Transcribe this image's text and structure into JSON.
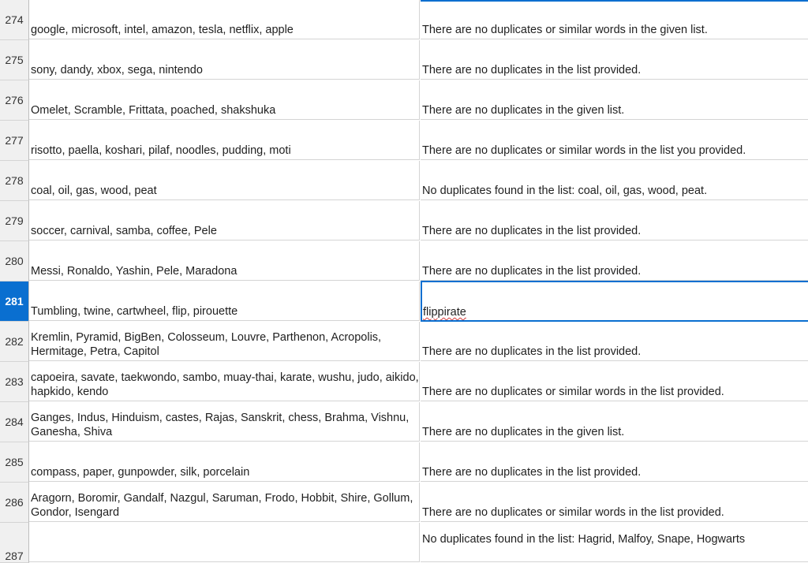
{
  "rows": [
    {
      "num": "274",
      "a": "google, microsoft, intel, amazon, tesla, netflix, apple",
      "b": "There are no duplicates or similar words in the given list."
    },
    {
      "num": "275",
      "a": "sony, dandy, xbox, sega, nintendo",
      "b": "There are no duplicates in the list provided."
    },
    {
      "num": "276",
      "a": "Omelet, Scramble, Frittata, poached, shakshuka",
      "b": "There are no duplicates in the given list."
    },
    {
      "num": "277",
      "a": "risotto, paella, koshari, pilaf, noodles, pudding, moti",
      "b": "There are no duplicates or similar words in the list you provided."
    },
    {
      "num": "278",
      "a": "coal, oil, gas, wood, peat",
      "b": "No duplicates found in the list: coal, oil, gas, wood, peat."
    },
    {
      "num": "279",
      "a": "soccer, carnival, samba, coffee, Pele",
      "b": "There are no duplicates in the list provided."
    },
    {
      "num": "280",
      "a": "Messi, Ronaldo, Yashin, Pele, Maradona",
      "b": "There are no duplicates in the list provided."
    },
    {
      "num": "281",
      "a": "Tumbling, twine, cartwheel, flip, pirouette",
      "b": "flippirate"
    },
    {
      "num": "282",
      "a": "Kremlin, Pyramid, BigBen, Colosseum, Louvre, Parthenon, Acropolis, Hermitage, Petra, Capitol",
      "b": "There are no duplicates in the list provided."
    },
    {
      "num": "283",
      "a": "capoeira, savate, taekwondo, sambo, muay-thai, karate, wushu, judo, aikido, hapkido, kendo",
      "b": "There are no duplicates or similar words in the list provided."
    },
    {
      "num": "284",
      "a": "Ganges, Indus, Hinduism, castes, Rajas, Sanskrit, chess, Brahma, Vishnu, Ganesha, Shiva",
      "b": "There are no duplicates in the given list."
    },
    {
      "num": "285",
      "a": "compass, paper, gunpowder, silk, porcelain",
      "b": "There are no duplicates in the list provided."
    },
    {
      "num": "286",
      "a": "Aragorn, Boromir, Gandalf, Nazgul, Saruman, Frodo, Hobbit, Shire, Gollum, Gondor, Isengard",
      "b": "There are no duplicates or similar words in the list provided."
    },
    {
      "num": "287",
      "a": "",
      "b": "No duplicates found in the list: Hagrid, Malfoy, Snape, Hogwarts"
    }
  ],
  "active_row": "281",
  "colors": {
    "accent": "#0a6fd0",
    "header_bg": "#f0f0f0",
    "grid_line": "#d4d4d4",
    "spell": "#d23b3b"
  }
}
